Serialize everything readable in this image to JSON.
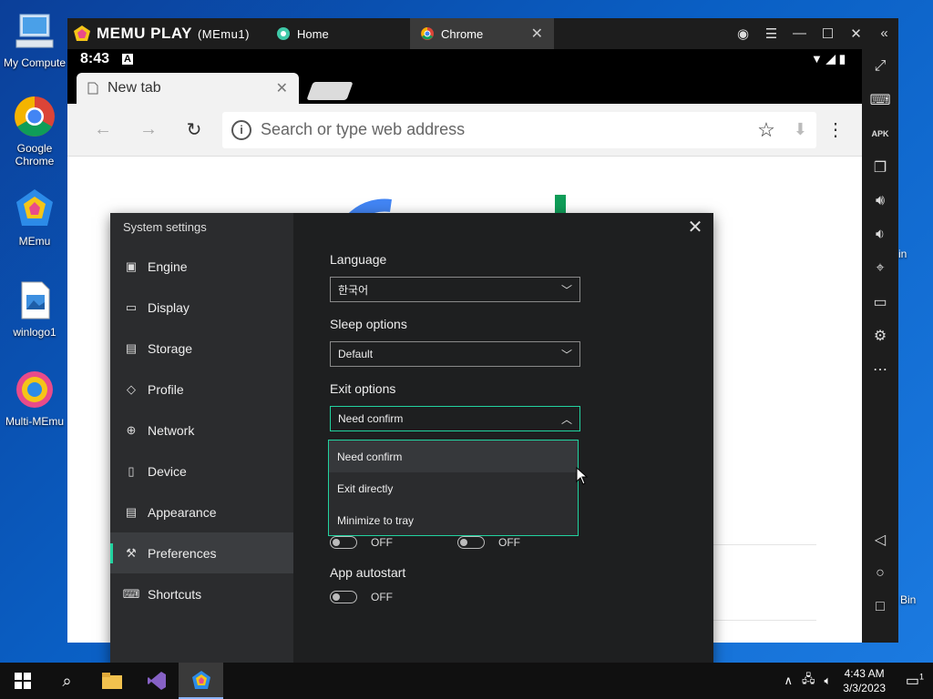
{
  "desktop": {
    "icons": [
      {
        "label": "My Compute"
      },
      {
        "label": "Google Chrome"
      },
      {
        "label": "MEmu"
      },
      {
        "label": "winlogo1"
      },
      {
        "label": "Multi-MEmu"
      }
    ],
    "partial_in": "in",
    "partial_bin": "Bin"
  },
  "emulator": {
    "brand": "MEMU PLAY",
    "instance": "(MEmu1)",
    "tabs": [
      {
        "label": "Home"
      },
      {
        "label": "Chrome"
      }
    ]
  },
  "android": {
    "time": "8:43",
    "notif_glyph": "A"
  },
  "chrome": {
    "tab_title": "New tab",
    "url_placeholder": "Search or type web address"
  },
  "settings": {
    "title": "System settings",
    "nav": [
      {
        "label": "Engine"
      },
      {
        "label": "Display"
      },
      {
        "label": "Storage"
      },
      {
        "label": "Profile"
      },
      {
        "label": "Network"
      },
      {
        "label": "Device"
      },
      {
        "label": "Appearance"
      },
      {
        "label": "Preferences"
      },
      {
        "label": "Shortcuts"
      }
    ],
    "active_nav": "Preferences",
    "language": {
      "label": "Language",
      "value": "한국어"
    },
    "sleep": {
      "label": "Sleep options",
      "value": "Default"
    },
    "exit": {
      "label": "Exit options",
      "value": "Need confirm",
      "options": [
        "Need confirm",
        "Exit directly",
        "Minimize to tray"
      ]
    },
    "toggle_a": {
      "state": "OFF"
    },
    "toggle_b": {
      "state": "OFF"
    },
    "autostart": {
      "label": "App autostart",
      "state": "OFF"
    },
    "accent": "#22d3a0"
  },
  "taskbar": {
    "time": "4:43 AM",
    "date": "3/3/2023",
    "notif_count": "1"
  }
}
